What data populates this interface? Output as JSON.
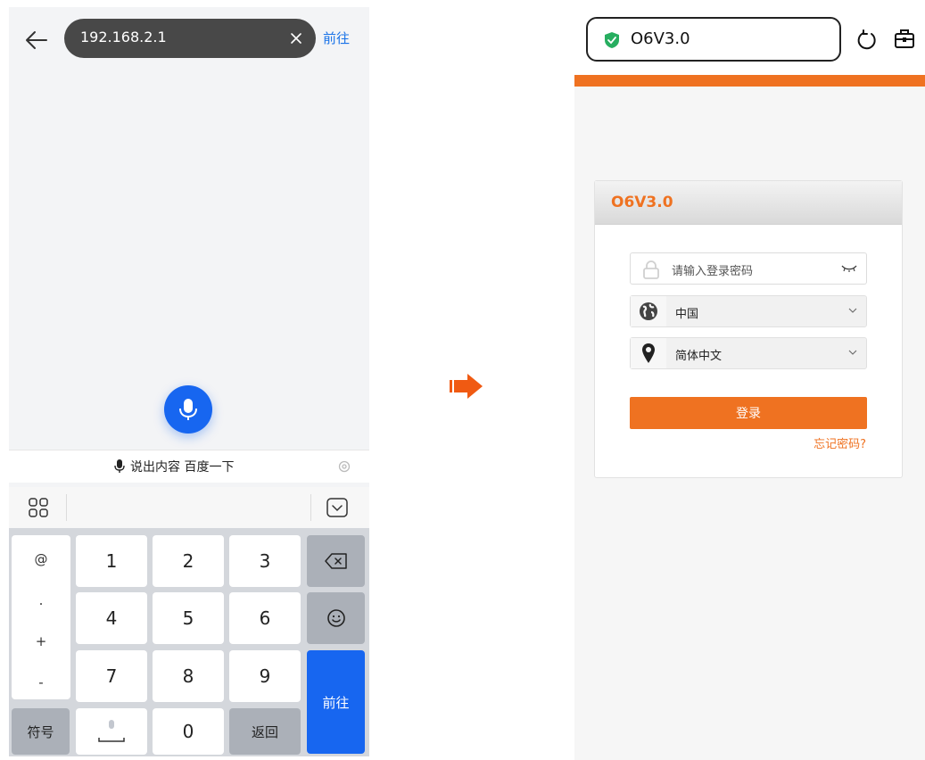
{
  "left_screen": {
    "url_value": "192.168.2.1",
    "go_label": "前往",
    "voice_hint": "说出内容 百度一下",
    "keyboard": {
      "symbols": [
        "@",
        ".",
        "+",
        "-"
      ],
      "rows": [
        [
          "1",
          "2",
          "3"
        ],
        [
          "4",
          "5",
          "6"
        ],
        [
          "7",
          "8",
          "9"
        ]
      ],
      "symbol_key": "符号",
      "zero": "0",
      "back_key": "返回",
      "enter_key": "前往"
    },
    "icons": {
      "back": "arrow-left-icon",
      "clear": "close-icon",
      "mic": "microphone-icon",
      "settings": "gear-icon",
      "grid": "grid-icon",
      "hide_keyboard": "chevron-down-icon",
      "backspace": "backspace-icon",
      "emoji": "emoji-icon",
      "space": "space-bar-icon"
    },
    "colors": {
      "accent": "#1766f0",
      "url_pill": "#484848",
      "keyboard_bg": "#d4d7dc"
    }
  },
  "right_screen": {
    "address_title": "O6V3.0",
    "card_title": "O6V3.0",
    "password_placeholder": "请输入登录密码",
    "region_value": "中国",
    "language_value": "简体中文",
    "login_button": "登录",
    "forgot_password": "忘记密码?",
    "icons": {
      "secure": "shield-check-icon",
      "reload": "reload-icon",
      "tabs": "tabs-icon",
      "lock": "lock-icon",
      "eye": "eye-closed-icon",
      "globe": "globe-icon",
      "location": "location-pin-icon",
      "chevron": "chevron-down-icon"
    },
    "colors": {
      "brand": "#ef7221",
      "secure": "#27ae60"
    }
  },
  "transition_icon": "arrow-right-icon"
}
